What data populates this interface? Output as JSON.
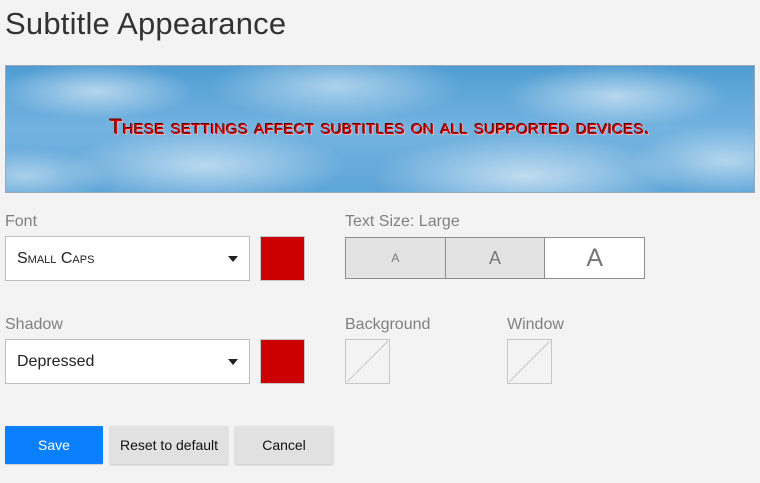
{
  "page": {
    "title": "Subtitle Appearance"
  },
  "preview": {
    "text": "These settings affect subtitles on all supported devices.",
    "text_color": "#cc0000"
  },
  "font": {
    "label": "Font",
    "value": "Small Caps",
    "color": "#cc0000"
  },
  "text_size": {
    "label": "Text Size: Large",
    "options": [
      {
        "label": "A",
        "size": "Small",
        "selected": false
      },
      {
        "label": "A",
        "size": "Medium",
        "selected": false
      },
      {
        "label": "A",
        "size": "Large",
        "selected": true
      }
    ]
  },
  "shadow": {
    "label": "Shadow",
    "value": "Depressed",
    "color": "#cc0000"
  },
  "background": {
    "label": "Background",
    "color": "none"
  },
  "window": {
    "label": "Window",
    "color": "none"
  },
  "actions": {
    "save_label": "Save",
    "reset_label": "Reset to default",
    "cancel_label": "Cancel"
  },
  "colors": {
    "accent": "#0a80ff",
    "swatch_red": "#cc0000"
  },
  "icons": {
    "dropdown": "chevron-down-icon",
    "no_color": "no-color-icon"
  }
}
